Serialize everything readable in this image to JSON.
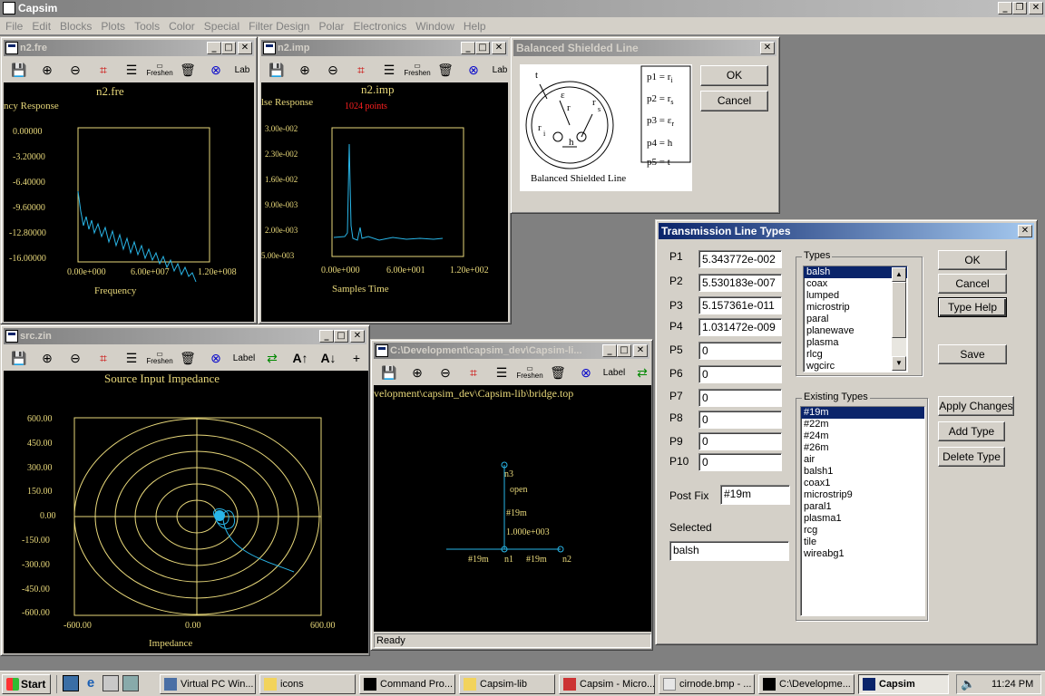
{
  "app": {
    "title": "Capsim",
    "menu": [
      "File",
      "Edit",
      "Blocks",
      "Plots",
      "Tools",
      "Color",
      "Special",
      "Filter Design",
      "Polar",
      "Electronics",
      "Window",
      "Help"
    ]
  },
  "toolbar": {
    "freshen": "Freshen",
    "label": "Label",
    "lab": "Lab"
  },
  "n2fre": {
    "title": "n2.fre",
    "plot_title": "n2.fre",
    "subtitle": "ncy Response",
    "xlabel": "Frequency",
    "yticks": [
      "0.00000",
      "-3.20000",
      "-6.40000",
      "-9.60000",
      "-12.80000",
      "-16.00000"
    ],
    "xticks": [
      "0.00e+000",
      "6.00e+007",
      "1.20e+008"
    ]
  },
  "n2imp": {
    "title": "n2.imp",
    "plot_title": "n2.imp",
    "subtitle": "lse Response",
    "points": "1024 points",
    "xlabel": "Samples Time",
    "yticks": [
      "3.00e-002",
      "2.30e-002",
      "1.60e-002",
      "9.00e-003",
      "2.00e-003",
      "5.00e-003"
    ],
    "xticks": [
      "0.00e+000",
      "6.00e+001",
      "1.20e+002"
    ]
  },
  "srczin": {
    "title": "src.zin",
    "plot_title": "Source Input Impedance",
    "xlabel": "Impedance",
    "yticks": [
      "600.00",
      "450.00",
      "300.00",
      "150.00",
      "0.00",
      "-150.00",
      "-300.00",
      "-450.00",
      "-600.00"
    ],
    "xticks": [
      "-600.00",
      "0.00",
      "600.00"
    ]
  },
  "bridge": {
    "title": "C:\\Development\\capsim_dev\\Capsim-li...",
    "path": "velopment\\capsim_dev\\Capsim-lib\\bridge.top",
    "status": "Ready",
    "nodes": {
      "n3": "n3",
      "open": "open",
      "type1": "#19m",
      "val": "1.000e+003",
      "left": "#19m",
      "n1": "n1",
      "right": "#19m",
      "n2": "n2"
    }
  },
  "bsl": {
    "title": "Balanced Shielded Line",
    "ok": "OK",
    "cancel": "Cancel",
    "caption": "Balanced Shielded Line",
    "params": [
      "p1 = r",
      "p2 = r",
      "p3 = ε",
      "p4 = h",
      "p5 = t"
    ],
    "subs": [
      "i",
      "s",
      "r",
      "",
      ""
    ],
    "labels": {
      "t": "t",
      "eps": "ε",
      "r": "r",
      "rs": "r",
      "s": "s",
      "ri": "r",
      "i": "i",
      "h": "h"
    }
  },
  "tlt": {
    "title": "Transmission Line Types",
    "params": [
      {
        "label": "P1",
        "value": "5.343772e-002"
      },
      {
        "label": "P2",
        "value": "5.530183e-007"
      },
      {
        "label": "P3",
        "value": "5.157361e-011"
      },
      {
        "label": "P4",
        "value": "1.031472e-009"
      },
      {
        "label": "P5",
        "value": "0"
      },
      {
        "label": "P6",
        "value": "0"
      },
      {
        "label": "P7",
        "value": "0"
      },
      {
        "label": "P8",
        "value": "0"
      },
      {
        "label": "P9",
        "value": "0"
      },
      {
        "label": "P10",
        "value": "0"
      }
    ],
    "postfix_label": "Post Fix",
    "postfix_value": "#19m",
    "selected_label": "Selected",
    "selected_value": "balsh",
    "types_label": "Types",
    "types": [
      "balsh",
      "coax",
      "lumped",
      "microstrip",
      "paral",
      "planewave",
      "plasma",
      "rlcg",
      "wgcirc"
    ],
    "existing_label": "Existing Types",
    "existing": [
      "#19m",
      "#22m",
      "#24m",
      "#26m",
      "air",
      "balsh1",
      "coax1",
      "microstrip9",
      "paral1",
      "plasma1",
      "rcg",
      "tile",
      "wireabg1"
    ],
    "ok": "OK",
    "cancel": "Cancel",
    "type_help": "Type Help",
    "save": "Save",
    "apply": "Apply Changes",
    "add": "Add Type",
    "delete": "Delete Type"
  },
  "taskbar": {
    "start": "Start",
    "tasks": [
      "Virtual PC Win...",
      "icons",
      "Command Pro...",
      "Capsim-lib",
      "Capsim - Micro...",
      "cirnode.bmp - ...",
      "C:\\Developme...",
      "Capsim"
    ],
    "clock": "11:24 PM"
  },
  "colors": {
    "accent": "#0a246a",
    "plot_yellow": "#e8d87a",
    "plot_trace": "#29b6e8",
    "plot_red": "#ff2020"
  }
}
